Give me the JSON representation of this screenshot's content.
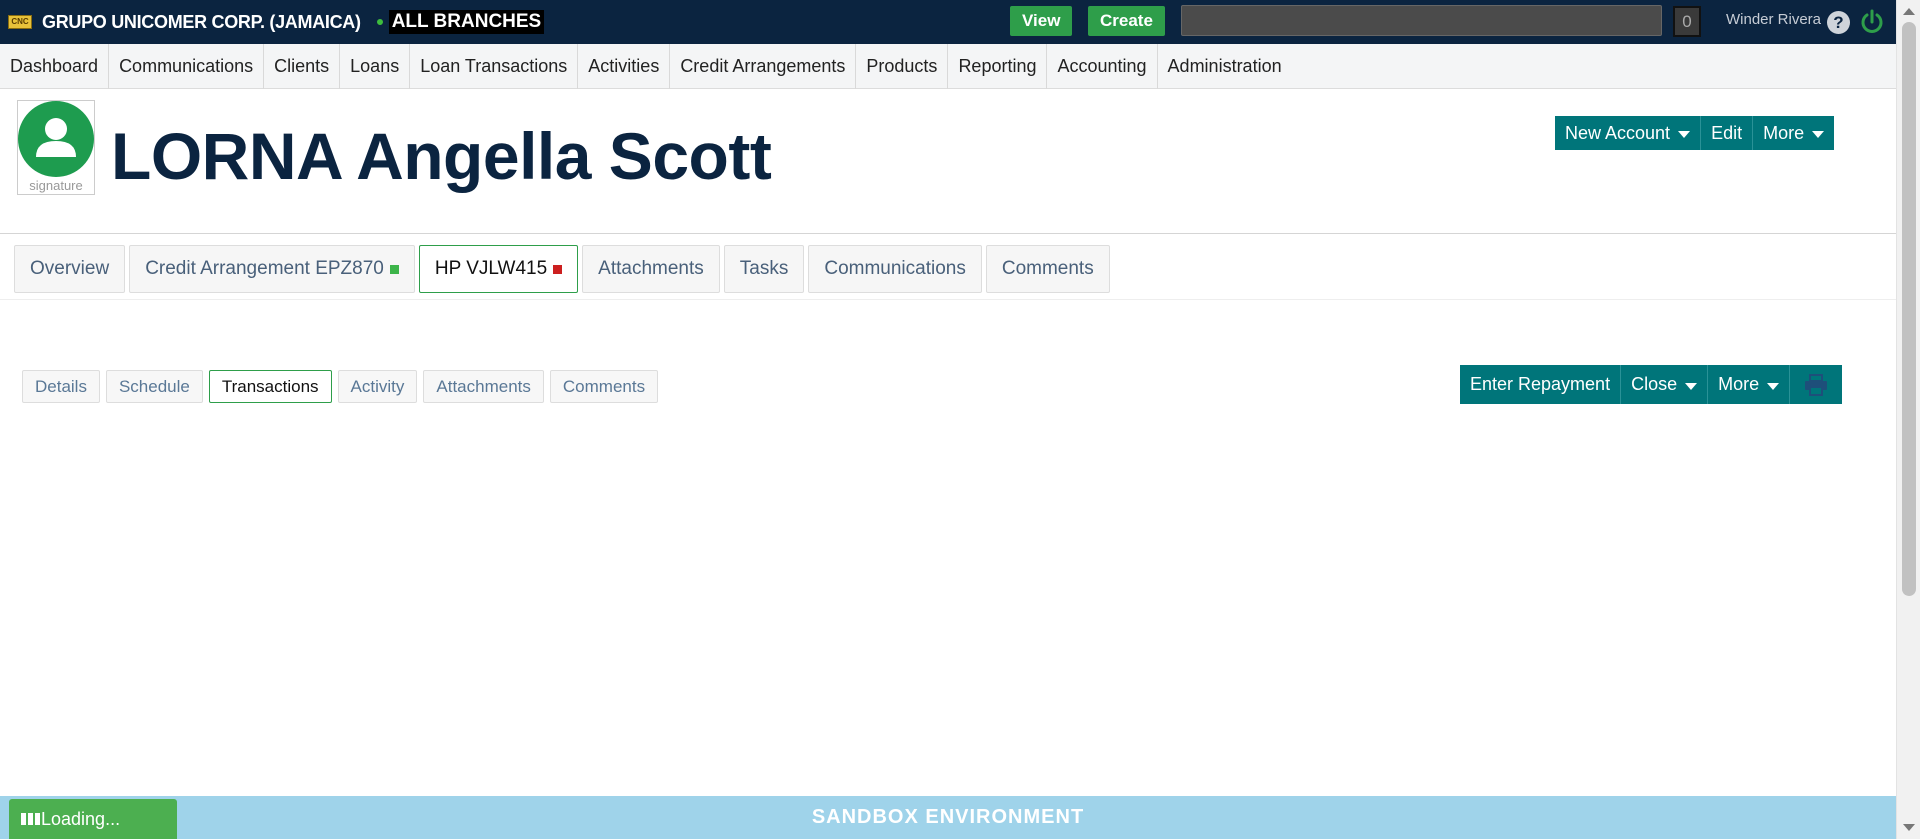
{
  "topbar": {
    "logo_text": "CNC",
    "company": "GRUPO UNICOMER CORP. (JAMAICA)",
    "branch": "ALL BRANCHES",
    "view_label": "View",
    "create_label": "Create",
    "search_value": "",
    "notification_count": "0",
    "user_name": "Winder Rivera",
    "help_glyph": "?",
    "colors": {
      "bar": "#0b2440",
      "green": "#2e9e4a",
      "power": "#2e9e4a"
    }
  },
  "menu": {
    "items": [
      "Dashboard",
      "Communications",
      "Clients",
      "Loans",
      "Loan Transactions",
      "Activities",
      "Credit Arrangements",
      "Products",
      "Reporting",
      "Accounting",
      "Administration"
    ]
  },
  "client": {
    "name": "LORNA Angella Scott",
    "avatar_caption": "signature",
    "avatar_color": "#1e9c4f"
  },
  "header_actions": {
    "new_account": "New Account",
    "edit": "Edit",
    "more": "More"
  },
  "tabs": [
    {
      "label": "Overview"
    },
    {
      "label": "Credit Arrangement EPZ870",
      "status_color": "#3db54a"
    },
    {
      "label": "HP VJLW415",
      "status_color": "#cc1f1f",
      "active": true
    },
    {
      "label": "Attachments"
    },
    {
      "label": "Tasks"
    },
    {
      "label": "Communications"
    },
    {
      "label": "Comments"
    }
  ],
  "subtabs": [
    {
      "label": "Details"
    },
    {
      "label": "Schedule"
    },
    {
      "label": "Transactions",
      "active": true
    },
    {
      "label": "Activity"
    },
    {
      "label": "Attachments"
    },
    {
      "label": "Comments"
    }
  ],
  "loan_actions": {
    "enter_repayment": "Enter Repayment",
    "close": "Close",
    "more": "More",
    "print_icon": "printer-icon",
    "accent": "#00757a"
  },
  "footer": {
    "environment": "SANDBOX ENVIRONMENT",
    "loading": "Loading..."
  }
}
